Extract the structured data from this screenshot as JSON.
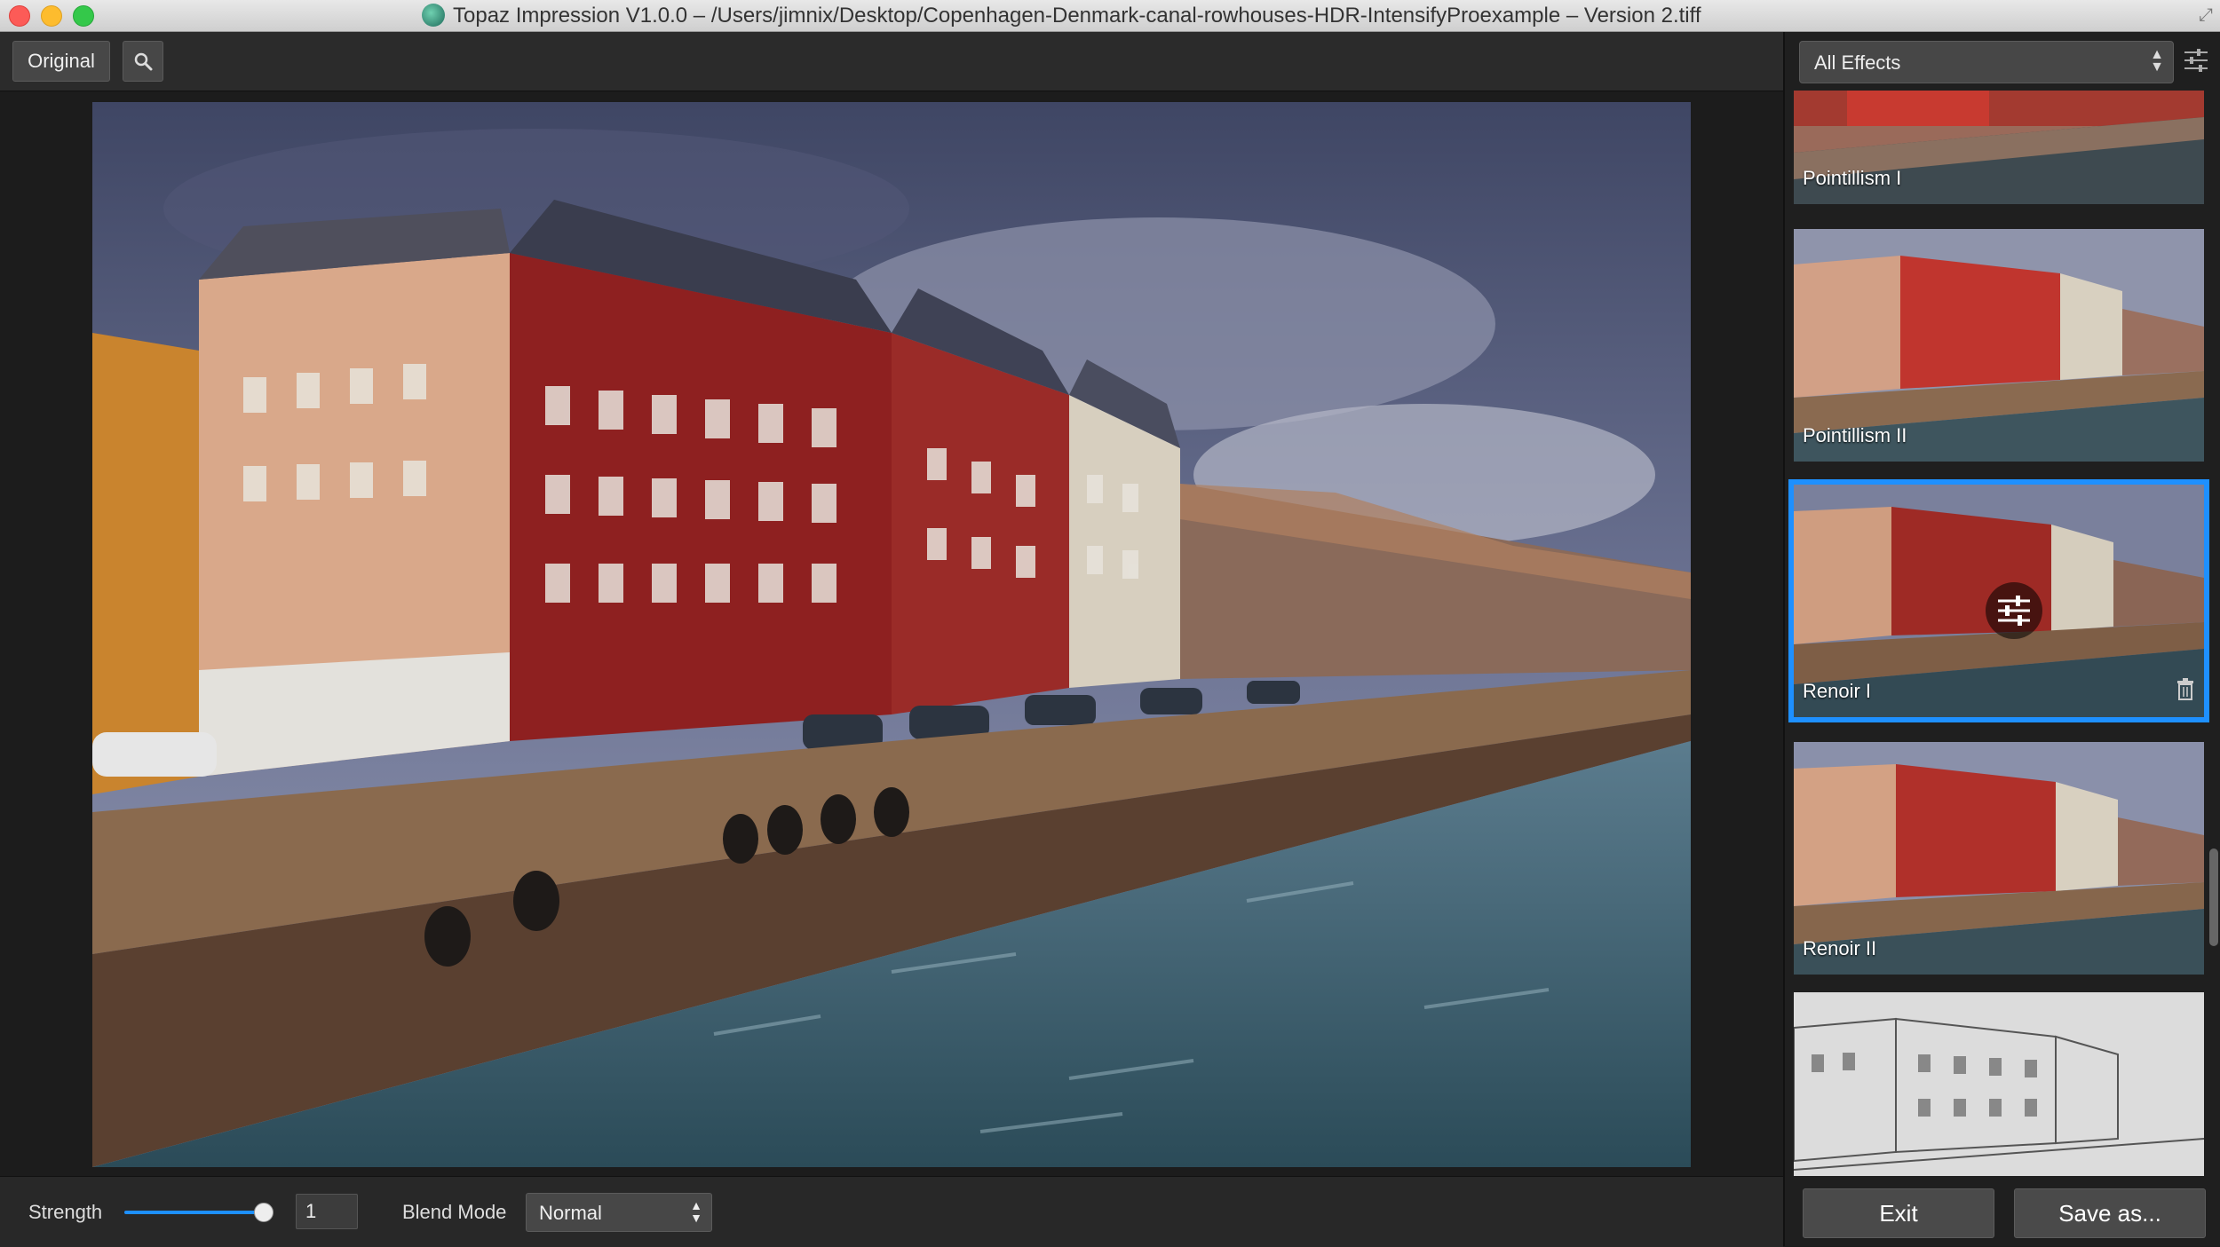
{
  "window": {
    "title": "Topaz Impression V1.0.0 – /Users/jimnix/Desktop/Copenhagen-Denmark-canal-rowhouses-HDR-IntensifyProexample – Version 2.tiff"
  },
  "toolbar": {
    "original_label": "Original",
    "search_icon": "magnifier-icon"
  },
  "sidebar": {
    "filter_value": "All Effects",
    "effects": [
      {
        "label": "Pointillism I",
        "selected": false
      },
      {
        "label": "Pointillism II",
        "selected": false
      },
      {
        "label": "Renoir I",
        "selected": true
      },
      {
        "label": "Renoir II",
        "selected": false
      },
      {
        "label": "",
        "selected": false
      }
    ]
  },
  "bottom": {
    "strength_label": "Strength",
    "strength_value": "1",
    "strength_level": 1.0,
    "blend_label": "Blend Mode",
    "blend_value": "Normal",
    "exit_label": "Exit",
    "save_label": "Save as..."
  },
  "colors": {
    "accent": "#1e90ff",
    "panel": "#2b2b2b"
  }
}
